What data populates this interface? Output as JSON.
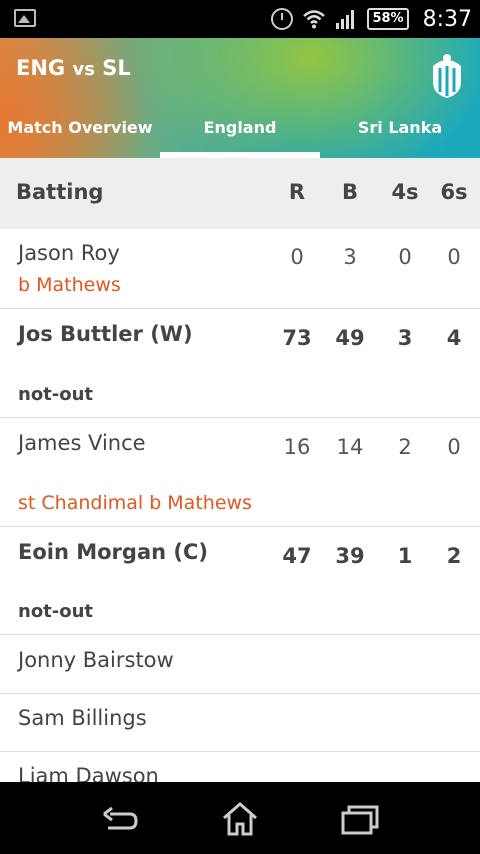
{
  "status_bar": {
    "battery": "58%",
    "time": "8:37"
  },
  "header": {
    "team1": "ENG",
    "vs": "vs",
    "team2": "SL"
  },
  "tabs": [
    {
      "label": "Match Overview",
      "active": false
    },
    {
      "label": "England",
      "active": true
    },
    {
      "label": "Sri Lanka",
      "active": false
    }
  ],
  "table": {
    "title": "Batting",
    "columns": [
      "R",
      "B",
      "4s",
      "6s"
    ],
    "rows": [
      {
        "name": "Jason Roy",
        "dismissal": "b Mathews",
        "r": "0",
        "b": "3",
        "fours": "0",
        "sixes": "0"
      },
      {
        "name": "Jos Buttler (W)",
        "dismissal": "not-out",
        "r": "73",
        "b": "49",
        "fours": "3",
        "sixes": "4"
      },
      {
        "name": "James Vince",
        "dismissal": "st Chandimal  b Mathews",
        "r": "16",
        "b": "14",
        "fours": "2",
        "sixes": "0"
      },
      {
        "name": "Eoin Morgan (C)",
        "dismissal": "not-out",
        "r": "47",
        "b": "39",
        "fours": "1",
        "sixes": "2"
      },
      {
        "name": "Jonny Bairstow"
      },
      {
        "name": "Sam Billings"
      },
      {
        "name": "Liam Dawson"
      }
    ]
  },
  "colors": {
    "accent": "#e8561e",
    "header_teal": "#1ba9bd",
    "header_green": "#9bc83c"
  },
  "icons": {
    "status": [
      "gallery-icon",
      "alarm-icon",
      "wifi-icon",
      "signal-icon",
      "battery-icon"
    ],
    "nav": [
      "back-icon",
      "home-icon",
      "recents-icon"
    ]
  }
}
